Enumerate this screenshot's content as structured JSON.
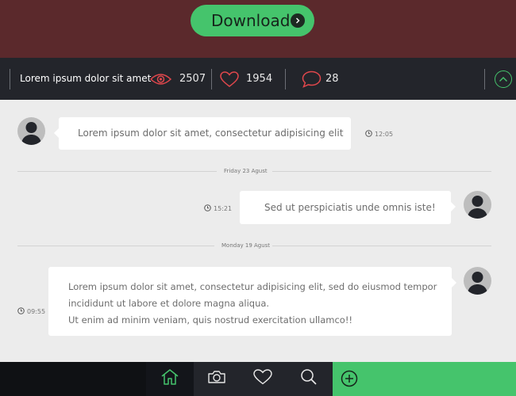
{
  "banner": {
    "download_label": "Download"
  },
  "stats": {
    "title": "Lorem ipsum dolor sit amet",
    "views": "2507",
    "likes": "1954",
    "comments": "28"
  },
  "messages": [
    {
      "side": "left",
      "text": "Lorem ipsum dolor sit amet, consectetur adipisicing elit",
      "time": "12:05"
    },
    {
      "side": "right",
      "text": "Sed ut perspiciatis unde omnis iste!",
      "time": "15:21"
    },
    {
      "side": "right",
      "text_lines": [
        "Lorem ipsum dolor sit amet, consectetur adipisicing elit, sed do eiusmod tempor",
        "incididunt ut labore et dolore magna aliqua.",
        "Ut enim ad minim veniam, quis nostrud exercitation ullamco!!"
      ],
      "time": "09:55"
    }
  ],
  "dividers": [
    "Friday 23 Agust",
    "Monday 19 Agust"
  ],
  "bottom_nav": {
    "items": [
      "home-icon",
      "camera-icon",
      "heart-icon",
      "search-icon",
      "plus-icon"
    ],
    "active": "home-icon"
  },
  "colors": {
    "accent": "#45c46c",
    "banner": "#5b292c",
    "bar": "#23252b",
    "icon_red": "#e0474c"
  }
}
